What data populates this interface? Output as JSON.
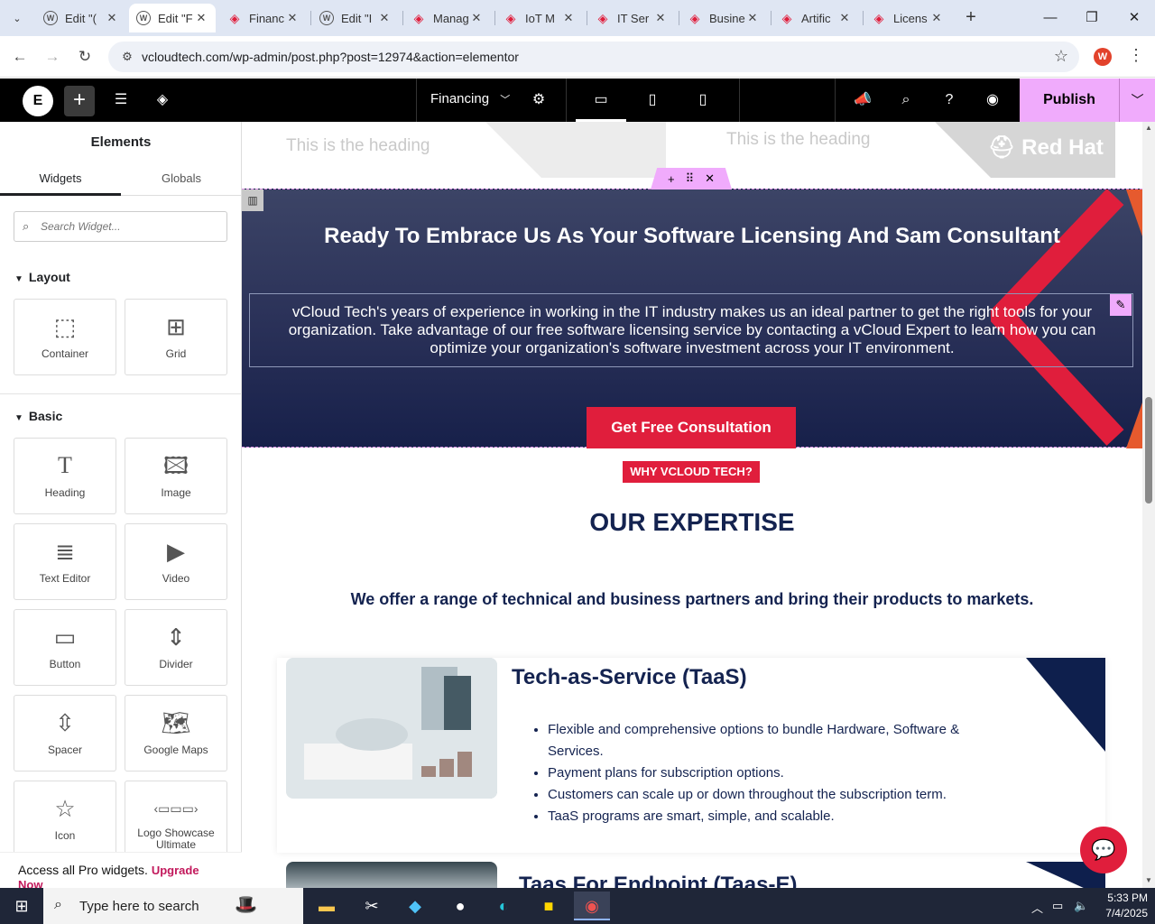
{
  "browser": {
    "tabs": [
      {
        "title": "Edit \"(",
        "icon": "wordpress-icon"
      },
      {
        "title": "Edit \"F",
        "icon": "wordpress-icon",
        "active": true
      },
      {
        "title": "Financ",
        "icon": "vcloud-icon"
      },
      {
        "title": "Edit \"I",
        "icon": "wordpress-icon"
      },
      {
        "title": "Manag",
        "icon": "vcloud-icon"
      },
      {
        "title": "IoT M",
        "icon": "vcloud-icon"
      },
      {
        "title": "IT Ser",
        "icon": "vcloud-icon"
      },
      {
        "title": "Busine",
        "icon": "vcloud-icon"
      },
      {
        "title": "Artific",
        "icon": "vcloud-icon"
      },
      {
        "title": "Licens",
        "icon": "vcloud-icon"
      }
    ],
    "url": "vcloudtech.com/wp-admin/post.php?post=12974&action=elementor",
    "profile_initial": "W"
  },
  "elementor_bar": {
    "page_name": "Financing",
    "publish_label": "Publish"
  },
  "panel": {
    "title": "Elements",
    "tabs": {
      "widgets": "Widgets",
      "globals": "Globals"
    },
    "search_placeholder": "Search Widget...",
    "layout_heading": "Layout",
    "basic_heading": "Basic",
    "layout_widgets": [
      "Container",
      "Grid"
    ],
    "basic_widgets": [
      "Heading",
      "Image",
      "Text Editor",
      "Video",
      "Button",
      "Divider",
      "Spacer",
      "Google Maps",
      "Icon",
      "Logo Showcase Ultimate"
    ],
    "pro_text": "Access all Pro widgets.",
    "pro_link": "Upgrade Now"
  },
  "canvas": {
    "top_heading_left": "This is the heading",
    "top_heading_right": "This is the heading",
    "redhat_logo": "Red Hat",
    "cta_title": "Ready To Embrace Us As Your Software Licensing And Sam Consultant",
    "cta_text": "vCloud Tech's years of experience in working in the IT industry makes us an ideal partner to get the right tools for your organization. Take advantage of our free software licensing service by contacting a vCloud Expert to learn how you can optimize your organization's software investment across your IT environment.",
    "cta_button": "Get Free Consultation",
    "why_badge": "WHY VCLOUD TECH?",
    "expertise_title": "OUR EXPERTISE",
    "offer_text": "We offer a range of technical and business partners and bring their products to markets.",
    "service1": {
      "title": "Tech-as-Service (TaaS)",
      "bullets": [
        "Flexible and comprehensive options to bundle Hardware, Software & Services.",
        "Payment plans for subscription options.",
        "Customers can scale up or down throughout the subscription term.",
        "TaaS programs are smart, simple, and scalable."
      ]
    },
    "service2": {
      "title": "Taas For Endpoint (Taas-E)"
    }
  },
  "taskbar": {
    "search_text": "Type here to search",
    "time": "5:33 PM",
    "date": "7/4/2025"
  },
  "colors": {
    "accent_red": "#e01e3c",
    "navy": "#142350",
    "elementor_pink": "#f0abfc"
  }
}
